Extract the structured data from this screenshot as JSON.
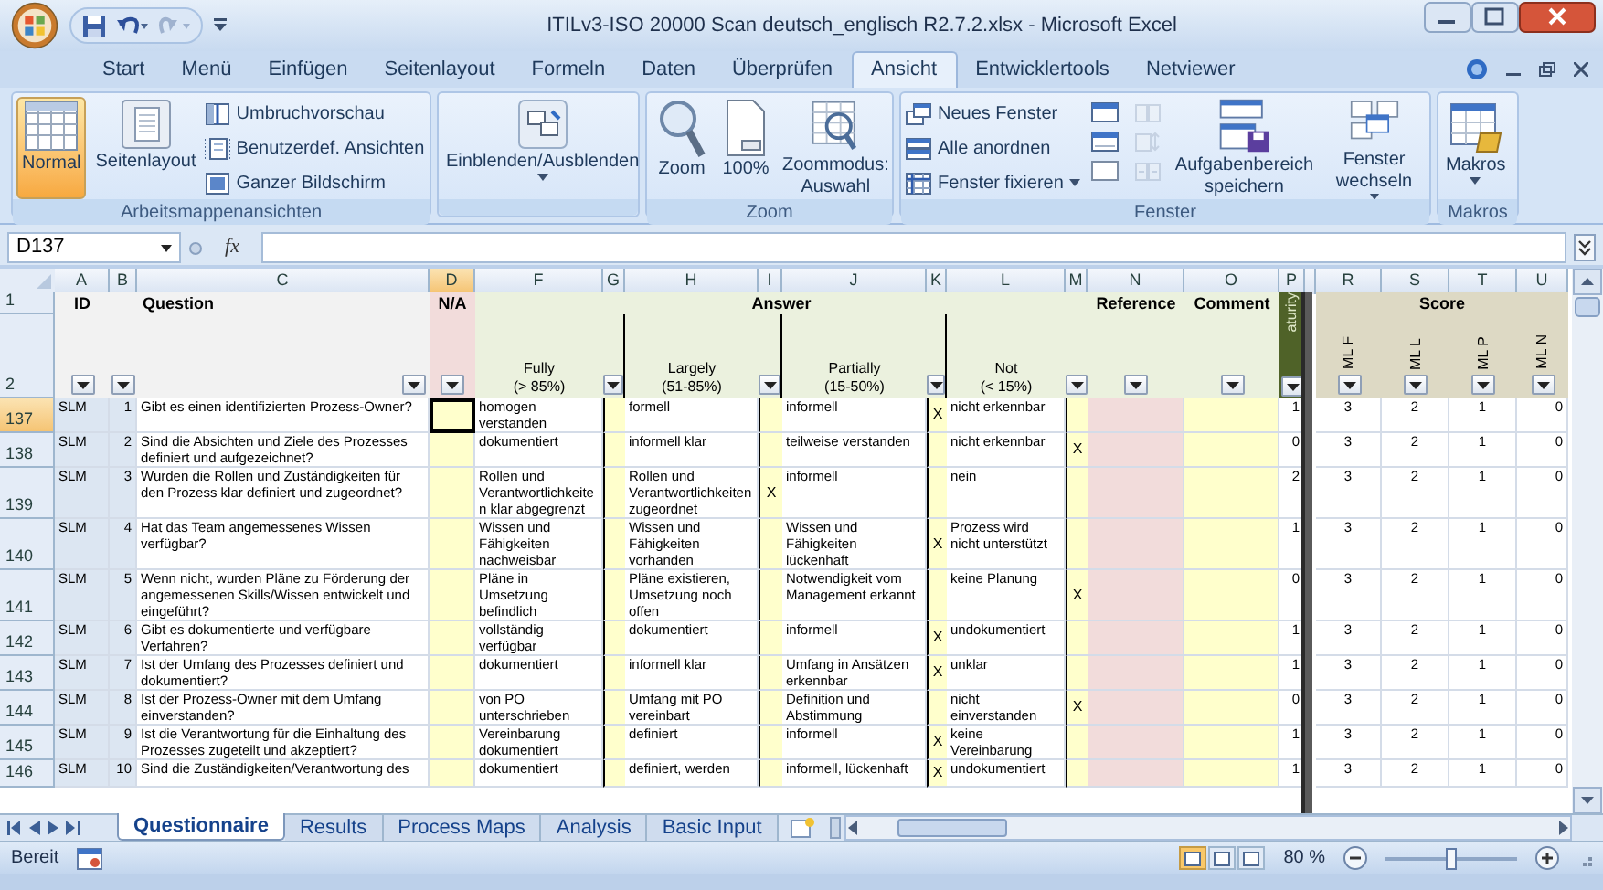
{
  "window": {
    "title": "ITILv3-ISO 20000 Scan deutsch_englisch R2.7.2.xlsx - Microsoft Excel"
  },
  "ribbon_tabs": [
    {
      "label": "Start",
      "selected": false
    },
    {
      "label": "Menü",
      "selected": false
    },
    {
      "label": "Einfügen",
      "selected": false
    },
    {
      "label": "Seitenlayout",
      "selected": false
    },
    {
      "label": "Formeln",
      "selected": false
    },
    {
      "label": "Daten",
      "selected": false
    },
    {
      "label": "Überprüfen",
      "selected": false
    },
    {
      "label": "Ansicht",
      "selected": true
    },
    {
      "label": "Entwicklertools",
      "selected": false
    },
    {
      "label": "Netviewer",
      "selected": false
    }
  ],
  "ribbon_groups": [
    {
      "label": "Arbeitsmappenansichten",
      "items": [
        {
          "kind": "large",
          "label": "Normal",
          "selected": true
        },
        {
          "kind": "large",
          "label": "Seitenlayout",
          "selected": false
        },
        {
          "kind": "stack",
          "entries": [
            {
              "label": "Umbruchvorschau"
            },
            {
              "label": "Benutzerdef. Ansichten"
            },
            {
              "label": "Ganzer Bildschirm"
            }
          ]
        }
      ]
    },
    {
      "items": [
        {
          "kind": "large",
          "label": "Einblenden/Ausblenden",
          "dropdown": true
        }
      ]
    },
    {
      "label": "Zoom",
      "items": [
        {
          "kind": "large",
          "label": "Zoom"
        },
        {
          "kind": "large",
          "label": "100%"
        },
        {
          "kind": "large",
          "label": "Zoommodus: Auswahl"
        }
      ]
    },
    {
      "label": "Fenster",
      "items": [
        {
          "kind": "stack",
          "entries": [
            {
              "label": "Neues Fenster"
            },
            {
              "label": "Alle anordnen"
            },
            {
              "label": "Fenster fixieren",
              "dropdown": true
            }
          ]
        },
        {
          "kind": "icons",
          "disabled": false
        },
        {
          "kind": "icons",
          "disabled": true
        },
        {
          "kind": "large",
          "label": "Aufgabenbereich speichern"
        },
        {
          "kind": "large",
          "label": "Fenster wechseln",
          "dropdown": true
        }
      ]
    },
    {
      "label": "Makros",
      "items": [
        {
          "kind": "large",
          "label": "Makros",
          "dropdown": true
        }
      ]
    }
  ],
  "formula_bar": {
    "name_box": "D137",
    "function_button": "fx"
  },
  "sheet": {
    "columns": [
      {
        "label": "A",
        "selected": false
      },
      {
        "label": "B",
        "selected": false
      },
      {
        "label": "C",
        "selected": false
      },
      {
        "label": "D",
        "selected": true
      },
      {
        "label": "F",
        "selected": false
      },
      {
        "label": "G",
        "selected": false
      },
      {
        "label": "H",
        "selected": false
      },
      {
        "label": "I",
        "selected": false
      },
      {
        "label": "J",
        "selected": false
      },
      {
        "label": "K",
        "selected": false
      },
      {
        "label": "L",
        "selected": false
      },
      {
        "label": "M",
        "selected": false
      },
      {
        "label": "N",
        "selected": false
      },
      {
        "label": "O",
        "selected": false
      },
      {
        "label": "P",
        "selected": false
      },
      {
        "label": "R",
        "selected": false
      },
      {
        "label": "S",
        "selected": false
      },
      {
        "label": "T",
        "selected": false
      },
      {
        "label": "U",
        "selected": false
      }
    ],
    "header": {
      "row_1": "1",
      "row_2": "2",
      "id": "ID",
      "question": "Question",
      "na": "N/A",
      "answer": "Answer",
      "reference": "Reference",
      "comment": "Comment",
      "maturity": "aturity",
      "score": "Score",
      "levels": [
        {
          "label": "Fully",
          "range": "(> 85%)"
        },
        {
          "label": "Largely",
          "range": "(51-85%)"
        },
        {
          "label": "Partially",
          "range": "(15-50%)"
        },
        {
          "label": "Not",
          "range": "(< 15%)"
        }
      ],
      "score_labels": [
        "ML F",
        "ML L",
        "ML P",
        "ML N"
      ]
    },
    "rows": [
      {
        "row": "137",
        "selected": true,
        "id": "SLM",
        "no": "1",
        "question": "Gibt es einen identifizierten Prozess-Owner?",
        "answers": [
          {
            "text": "homogen verstanden"
          },
          {
            "text": "formell"
          },
          {
            "text": "informell",
            "mark": "X"
          },
          {
            "text": "nicht erkennbar"
          }
        ],
        "maturity": "1",
        "scores": [
          "3",
          "2",
          "1",
          "0"
        ]
      },
      {
        "row": "138",
        "selected": false,
        "id": "SLM",
        "no": "2",
        "question": "Sind die Absichten und Ziele des Prozesses definiert und aufgezeichnet?",
        "answers": [
          {
            "text": "dokumentiert"
          },
          {
            "text": "informell klar"
          },
          {
            "text": "teilweise verstanden"
          },
          {
            "text": "nicht erkennbar",
            "mark": "X"
          }
        ],
        "maturity": "0",
        "scores": [
          "3",
          "2",
          "1",
          "0"
        ]
      },
      {
        "row": "139",
        "selected": false,
        "id": "SLM",
        "no": "3",
        "question": "Wurden die Rollen und Zuständigkeiten für den Prozess klar definiert und zugeordnet?",
        "answers": [
          {
            "text": "Rollen und Verantwortlichkeiten klar abgegrenzt"
          },
          {
            "text": "Rollen und Verantwortlichkeiten zugeordnet",
            "mark": "X"
          },
          {
            "text": "informell"
          },
          {
            "text": "nein"
          }
        ],
        "maturity": "2",
        "scores": [
          "3",
          "2",
          "1",
          "0"
        ]
      },
      {
        "row": "140",
        "selected": false,
        "id": "SLM",
        "no": "4",
        "question": "Hat das Team angemessenes Wissen verfügbar?",
        "answers": [
          {
            "text": "Wissen und Fähigkeiten nachweisbar"
          },
          {
            "text": "Wissen und Fähigkeiten vorhanden"
          },
          {
            "text": "Wissen und Fähigkeiten lückenhaft",
            "mark": "X"
          },
          {
            "text": "Prozess wird nicht unterstützt"
          }
        ],
        "maturity": "1",
        "scores": [
          "3",
          "2",
          "1",
          "0"
        ]
      },
      {
        "row": "141",
        "selected": false,
        "id": "SLM",
        "no": "5",
        "question": "Wenn nicht, wurden Pläne zu Förderung der angemessenen Skills/Wissen entwickelt und eingeführt?",
        "answers": [
          {
            "text": "Pläne in Umsetzung befindlich"
          },
          {
            "text": "Pläne existieren, Umsetzung noch offen"
          },
          {
            "text": "Notwendigkeit vom Management erkannt"
          },
          {
            "text": "keine Planung",
            "mark": "X"
          }
        ],
        "maturity": "0",
        "scores": [
          "3",
          "2",
          "1",
          "0"
        ]
      },
      {
        "row": "142",
        "selected": false,
        "id": "SLM",
        "no": "6",
        "question": "Gibt es dokumentierte und verfügbare Verfahren?",
        "answers": [
          {
            "text": "vollständig verfügbar"
          },
          {
            "text": "dokumentiert"
          },
          {
            "text": "informell",
            "mark": "X"
          },
          {
            "text": "undokumentiert"
          }
        ],
        "maturity": "1",
        "scores": [
          "3",
          "2",
          "1",
          "0"
        ]
      },
      {
        "row": "143",
        "selected": false,
        "id": "SLM",
        "no": "7",
        "question": "Ist der Umfang des Prozesses definiert und dokumentiert?",
        "answers": [
          {
            "text": "dokumentiert"
          },
          {
            "text": "informell klar"
          },
          {
            "text": "Umfang in Ansätzen erkennbar",
            "mark": "X"
          },
          {
            "text": "unklar"
          }
        ],
        "maturity": "1",
        "scores": [
          "3",
          "2",
          "1",
          "0"
        ]
      },
      {
        "row": "144",
        "selected": false,
        "id": "SLM",
        "no": "8",
        "question": "Ist der Prozess-Owner mit dem Umfang einverstanden?",
        "answers": [
          {
            "text": "von PO unterschrieben"
          },
          {
            "text": "Umfang mit PO vereinbart"
          },
          {
            "text": "Definition und Abstimmung"
          },
          {
            "text": "nicht einverstanden",
            "mark": "X"
          }
        ],
        "maturity": "0",
        "scores": [
          "3",
          "2",
          "1",
          "0"
        ]
      },
      {
        "row": "145",
        "selected": false,
        "id": "SLM",
        "no": "9",
        "question": "Ist die Verantwortung für die Einhaltung des Prozesses zugeteilt und akzeptiert?",
        "answers": [
          {
            "text": "Vereinbarung dokumentiert"
          },
          {
            "text": "definiert"
          },
          {
            "text": "informell",
            "mark": "X"
          },
          {
            "text": "keine Vereinbarung"
          }
        ],
        "maturity": "1",
        "scores": [
          "3",
          "2",
          "1",
          "0"
        ]
      },
      {
        "row": "146",
        "selected": false,
        "id": "SLM",
        "no": "10",
        "question": "Sind die Zuständigkeiten/Verantwortung des",
        "answers": [
          {
            "text": "dokumentiert"
          },
          {
            "text": "definiert, werden"
          },
          {
            "text": "informell, lückenhaft",
            "mark": "X"
          },
          {
            "text": "undokumentiert"
          }
        ],
        "maturity": "1",
        "scores": [
          "3",
          "2",
          "1",
          "0"
        ]
      }
    ]
  },
  "sheet_tabs": [
    {
      "label": "Questionnaire",
      "selected": true
    },
    {
      "label": "Results",
      "selected": false
    },
    {
      "label": "Process Maps",
      "selected": false
    },
    {
      "label": "Analysis",
      "selected": false
    },
    {
      "label": "Basic Input",
      "selected": false
    }
  ],
  "status_bar": {
    "status": "Bereit",
    "view_buttons": [
      {
        "selected": true
      },
      {
        "selected": false
      },
      {
        "selected": false
      }
    ],
    "zoom": "80 %",
    "zoom_slider": {
      "level": 0.5
    }
  }
}
